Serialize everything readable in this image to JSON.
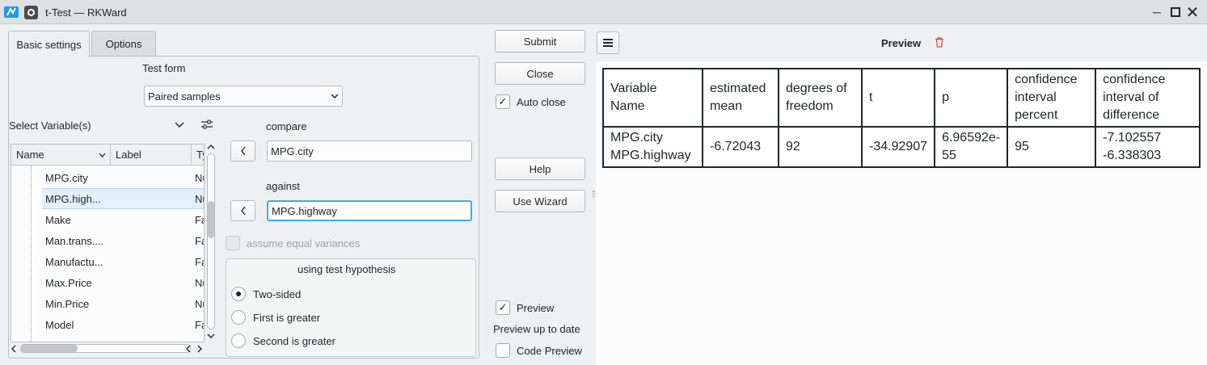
{
  "window": {
    "title": "t-Test — RKWard"
  },
  "tabs": [
    {
      "label": "Basic settings"
    },
    {
      "label": "Options"
    }
  ],
  "test_form": {
    "label": "Test form",
    "selected": "Paired samples"
  },
  "variable_selector": {
    "label": "Select Variable(s)",
    "columns": [
      "Name",
      "Label",
      "Ty"
    ],
    "rows": [
      {
        "name": "MPG.city",
        "type": "Nu"
      },
      {
        "name": "MPG.high...",
        "type": "Nu"
      },
      {
        "name": "Make",
        "type": "Fa"
      },
      {
        "name": "Man.trans....",
        "type": "Fa"
      },
      {
        "name": "Manufactu...",
        "type": "Fa"
      },
      {
        "name": "Max.Price",
        "type": "Nu"
      },
      {
        "name": "Min.Price",
        "type": "Nu"
      },
      {
        "name": "Model",
        "type": "Fa"
      }
    ]
  },
  "compare": {
    "label": "compare",
    "value": "MPG.city"
  },
  "against": {
    "label": "against",
    "value": "MPG.highway"
  },
  "equal_variances": {
    "label": "assume equal variances"
  },
  "hypothesis": {
    "title": "using test hypothesis",
    "options": [
      {
        "label": "Two-sided"
      },
      {
        "label": "First is greater"
      },
      {
        "label": "Second is greater"
      }
    ],
    "selected": "Two-sided"
  },
  "actions": {
    "submit": "Submit",
    "close": "Close",
    "auto_close": "Auto close",
    "help": "Help",
    "use_wizard": "Use Wizard",
    "preview": "Preview",
    "preview_status": "Preview up to date",
    "code_preview": "Code Preview"
  },
  "preview_pane": {
    "title": "Preview"
  },
  "results": {
    "headers": [
      [
        "Variable",
        "Name"
      ],
      [
        "estimated",
        "mean"
      ],
      [
        "degrees of",
        "freedom"
      ],
      [
        "t"
      ],
      [
        "p"
      ],
      [
        "confidence",
        "interval",
        "percent"
      ],
      [
        "confidence",
        "interval of",
        "difference"
      ]
    ],
    "row": [
      [
        "MPG.city",
        "MPG.highway"
      ],
      [
        "-6.72043"
      ],
      [
        "92"
      ],
      [
        "-34.92907"
      ],
      [
        "6.96592e-",
        "55"
      ],
      [
        "95"
      ],
      [
        "-7.102557",
        "-6.338303"
      ]
    ]
  }
}
